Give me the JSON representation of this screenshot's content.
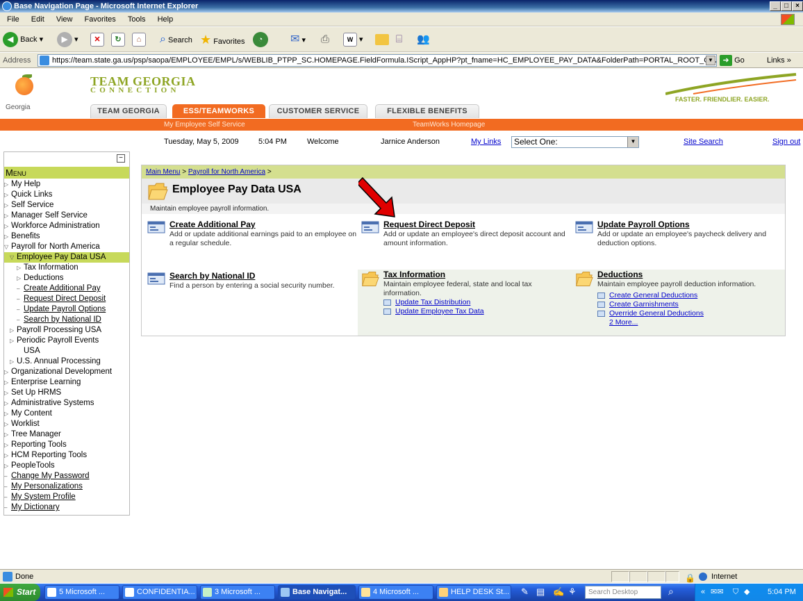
{
  "window": {
    "title": "Base Navigation Page - Microsoft Internet Explorer",
    "controls": [
      "_",
      "□",
      "×"
    ]
  },
  "menubar": [
    "File",
    "Edit",
    "View",
    "Favorites",
    "Tools",
    "Help"
  ],
  "toolbar": {
    "back_label": "Back",
    "search_label": "Search",
    "favorites_label": "Favorites"
  },
  "addressbar": {
    "label": "Address",
    "url": "https://team.state.ga.us/psp/saopa/EMPLOYEE/EMPL/s/WEBLIB_PTPP_SC.HOMEPAGE.FieldFormula.IScript_AppHP?pt_fname=HC_EMPLOYEE_PAY_DATA&FolderPath=PORTAL_ROOT_OBJECT.HC_N",
    "go_label": "Go",
    "links_label": "Links »"
  },
  "header": {
    "logo_text": "Georgia",
    "brand_line1": "TEAM GEORGIA",
    "brand_line2": "CONNECTION",
    "slogan": "FASTER. FRIENDLIER. EASIER.",
    "tabs": [
      {
        "label": "TEAM GEORGIA"
      },
      {
        "label": "ESS/TEAMWORKS"
      },
      {
        "label": "CUSTOMER SERVICE"
      },
      {
        "label": "FLEXIBLE BENEFITS"
      }
    ],
    "subnav_left": "My Employee Self Service",
    "subnav_right": "TeamWorks Homepage"
  },
  "userrow": {
    "date": "Tuesday, May 5, 2009",
    "time": "5:04 PM",
    "welcome": "Welcome",
    "user": "Jarnice Anderson",
    "mylinks_label": "My Links",
    "mylinks_value": "Select One:",
    "site_search": "Site Search",
    "sign_out": "Sign out"
  },
  "leftnav": {
    "title": "Menu",
    "items": [
      "My Help",
      "Quick Links",
      "Self Service",
      "Manager Self Service",
      "Workforce Administration",
      "Benefits",
      "Payroll for North America",
      "Employee Pay Data USA",
      "Tax Information",
      "Deductions",
      "Create Additional Pay",
      "Request Direct Deposit",
      "Update Payroll Options",
      "Search by National ID",
      "Payroll Processing USA",
      "Periodic Payroll Events",
      "USA",
      "U.S. Annual Processing",
      "Organizational Development",
      "Enterprise Learning",
      "Set Up HRMS",
      "Administrative Systems",
      "My Content",
      "Worklist",
      "Tree Manager",
      "Reporting Tools",
      "HCM Reporting Tools",
      "PeopleTools",
      "Change My Password",
      "My Personalizations",
      "My System Profile",
      "My Dictionary"
    ]
  },
  "content": {
    "breadcrumb": [
      "Main Menu",
      "Payroll for North America"
    ],
    "breadcrumb_sep": ">",
    "title": "Employee Pay Data USA",
    "description": "Maintain employee payroll information.",
    "cells": {
      "create_pay": {
        "title": "Create Additional Pay",
        "desc": "Add or update additional earnings paid to an employee on a regular schedule."
      },
      "direct_deposit": {
        "title": "Request Direct Deposit",
        "desc": "Add or update an employee's direct deposit account and amount information."
      },
      "payroll_options": {
        "title": "Update Payroll Options",
        "desc": "Add or update an employee's paycheck delivery and deduction options."
      },
      "search_id": {
        "title": "Search by National ID",
        "desc": "Find a person by entering a social security number."
      },
      "tax_info": {
        "title": "Tax Information",
        "desc": "Maintain employee federal, state and local tax information.",
        "links": [
          "Update Tax Distribution",
          "Update Employee Tax Data"
        ]
      },
      "deductions": {
        "title": "Deductions",
        "desc": "Maintain employee payroll deduction information.",
        "links": [
          "Create General Deductions",
          "Create Garnishments",
          "Override General Deductions"
        ],
        "more": "2 More..."
      }
    }
  },
  "statusbar": {
    "status": "Done",
    "zone": "Internet"
  },
  "taskbar": {
    "start": "Start",
    "tasks": [
      "5 Microsoft ...",
      "CONFIDENTIA...",
      "3 Microsoft ...",
      "Base Navigat...",
      "4 Microsoft ...",
      "HELP DESK St..."
    ],
    "search_placeholder": "Search Desktop",
    "clock": "5:04 PM"
  },
  "colors": {
    "orange": "#f26b21",
    "green": "#8ea524",
    "menu_green": "#c7d95a",
    "annotation_arrow": "#e00000"
  }
}
